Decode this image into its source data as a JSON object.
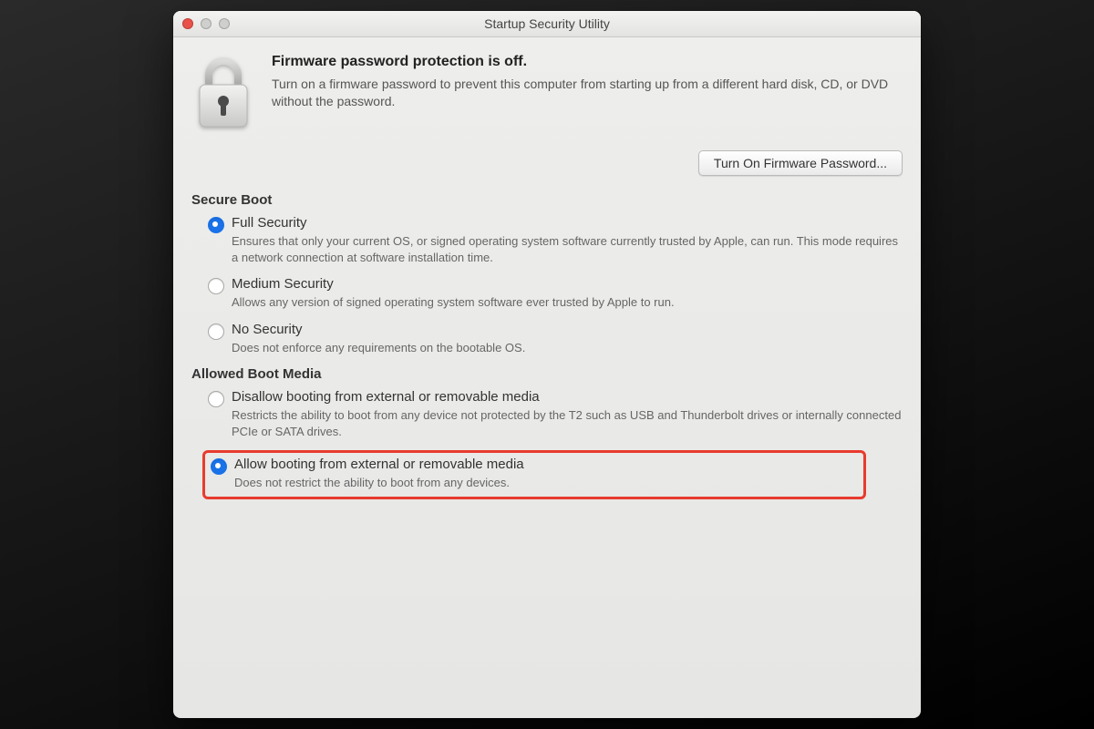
{
  "window": {
    "title": "Startup Security Utility"
  },
  "firmware": {
    "heading": "Firmware password protection is off.",
    "description": "Turn on a firmware password to prevent this computer from starting up from a different hard disk, CD, or DVD without the password.",
    "button": "Turn On Firmware Password..."
  },
  "secure_boot": {
    "title": "Secure Boot",
    "options": [
      {
        "label": "Full Security",
        "desc": "Ensures that only your current OS, or signed operating system software currently trusted by Apple, can run. This mode requires a network connection at software installation time.",
        "checked": true
      },
      {
        "label": "Medium Security",
        "desc": "Allows any version of signed operating system software ever trusted by Apple to run.",
        "checked": false
      },
      {
        "label": "No Security",
        "desc": "Does not enforce any requirements on the bootable OS.",
        "checked": false
      }
    ]
  },
  "boot_media": {
    "title": "Allowed Boot Media",
    "options": [
      {
        "label": "Disallow booting from external or removable media",
        "desc": "Restricts the ability to boot from any device not protected by the T2 such as USB and Thunderbolt drives or internally connected PCIe or SATA drives.",
        "checked": false
      },
      {
        "label": "Allow booting from external or removable media",
        "desc": "Does not restrict the ability to boot from any devices.",
        "checked": true
      }
    ]
  }
}
